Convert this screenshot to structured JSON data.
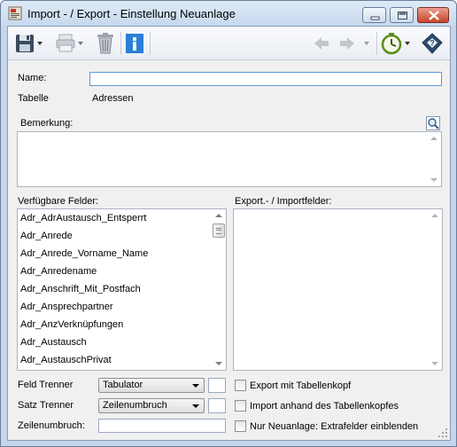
{
  "window": {
    "title": "Import - / Export - Einstellung Neuanlage",
    "icon": "import-export-app-icon"
  },
  "toolbar": {
    "icons": [
      "save-icon",
      "print-icon",
      "trash-icon",
      "info-icon",
      "back-arrow-icon",
      "forward-arrow-icon",
      "timer-icon",
      "help-book-icon"
    ]
  },
  "form": {
    "name_label": "Name:",
    "name_value": "",
    "tabelle_label": "Tabelle",
    "tabelle_value": "Adressen",
    "bemerkung_label": "Bemerkung:",
    "available_label": "Verfügbare Felder:",
    "export_label": "Export.- / Importfelder:",
    "available_fields": [
      "Adr_AdrAustausch_Entsperrt",
      "Adr_Anrede",
      "Adr_Anrede_Vorname_Name",
      "Adr_Anredename",
      "Adr_Anschrift_Mit_Postfach",
      "Adr_Ansprechpartner",
      "Adr_AnzVerknüpfungen",
      "Adr_Austausch",
      "Adr_AustauschPrivat"
    ],
    "feld_trenner_label": "Feld Trenner",
    "feld_trenner_value": "Tabulator",
    "satz_trenner_label": "Satz Trenner",
    "satz_trenner_value": "Zeilenumbruch",
    "zeilenumbruch_label": "Zeilenumbruch:",
    "zeilenumbruch_value": "",
    "cb_export_header": "Export mit Tabellenkopf",
    "cb_import_header": "Import anhand des Tabellenkopfes",
    "cb_extra_fields": "Nur Neuanlage: Extrafelder einblenden"
  },
  "colors": {
    "titlebar": "#c7d9ee",
    "client_bg": "#f0f0f0",
    "close_button": "#c6442b",
    "info_blue": "#2a7fd6"
  }
}
